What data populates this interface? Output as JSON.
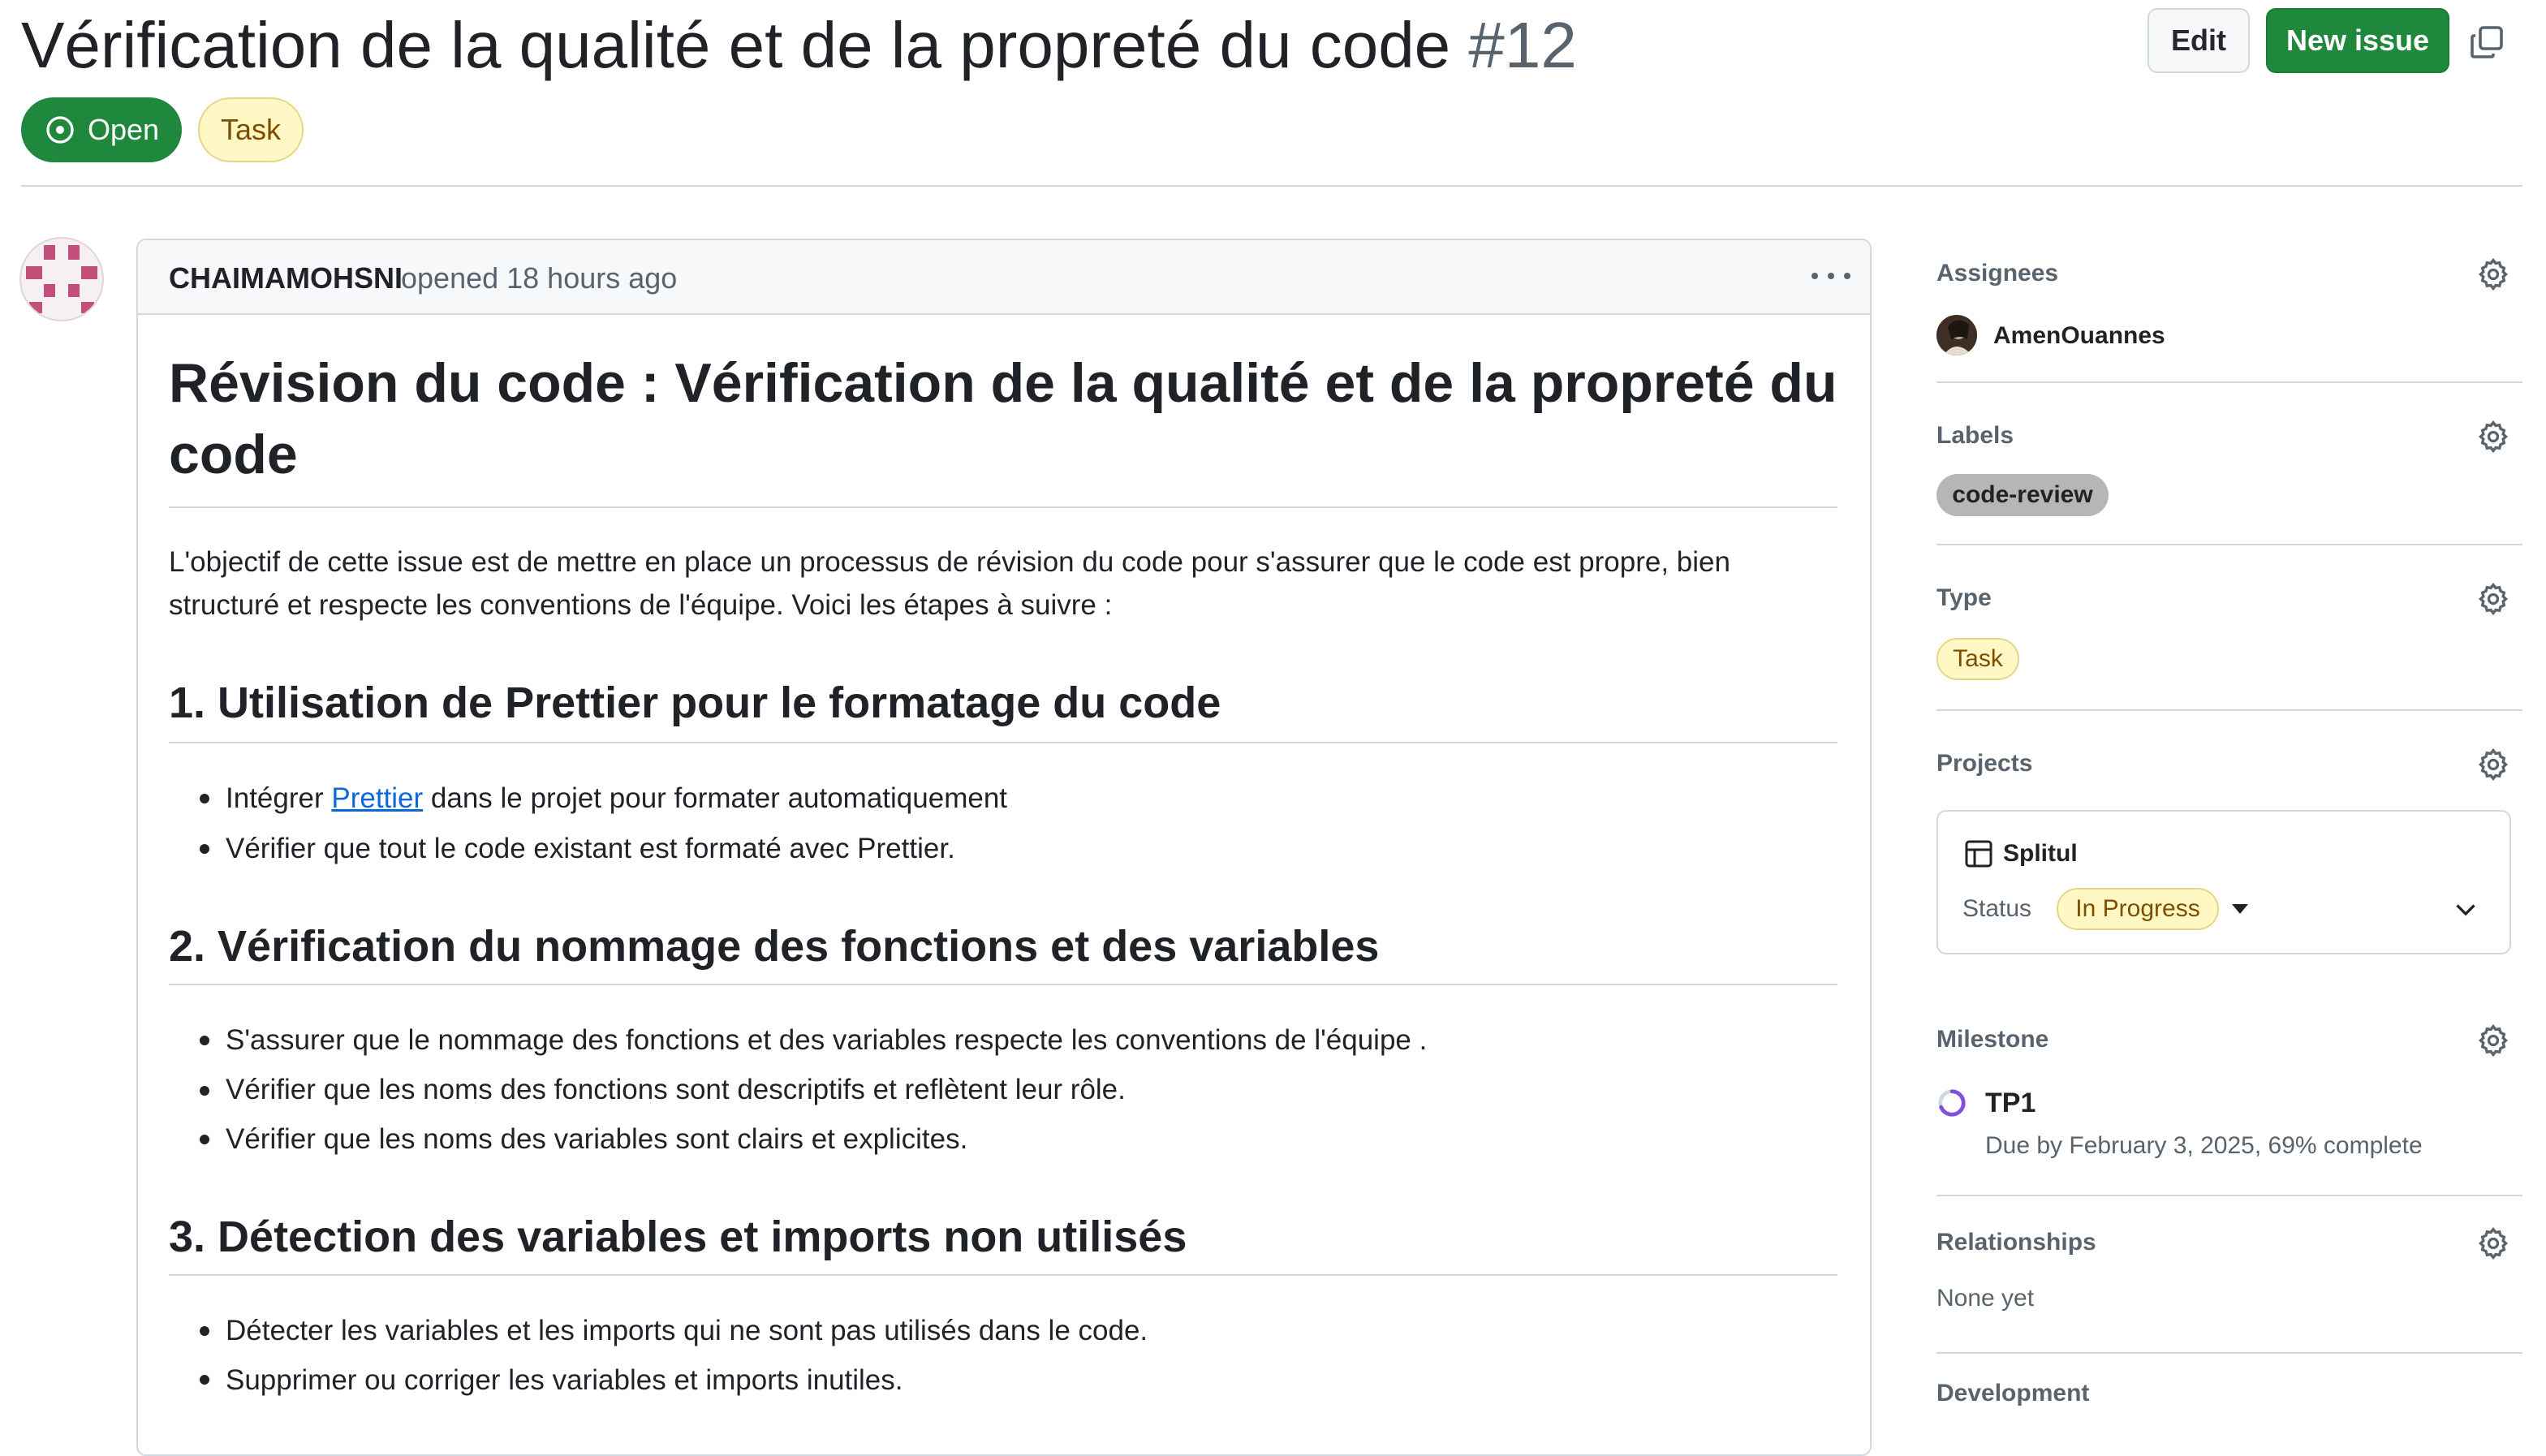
{
  "issue": {
    "title": "Vérification de la qualité et de la propreté du code",
    "number": "#12",
    "state": "Open",
    "type": "Task"
  },
  "toolbar": {
    "edit_label": "Edit",
    "new_issue_label": "New issue"
  },
  "comment": {
    "author": "CHAIMAMOHSNI",
    "opened_text": "opened 18 hours ago",
    "heading": "Révision du code : Vérification de la qualité et de la propreté du code",
    "intro": "L'objectif de cette issue est de mettre en place un processus de révision du code pour s'assurer que le code est propre, bien structuré et respecte les conventions de l'équipe. Voici les étapes à suivre :",
    "sections": [
      {
        "title": "1. Utilisation de Prettier pour le formatage du code",
        "items": [
          {
            "before": "Intégrer ",
            "link": "Prettier",
            "after": " dans le projet pour formater automatiquement"
          },
          {
            "text": "Vérifier que tout le code existant est formaté avec Prettier."
          }
        ]
      },
      {
        "title": "2. Vérification du nommage des fonctions et des variables",
        "items": [
          {
            "text": "S'assurer que le nommage des fonctions et des variables respecte les conventions de l'équipe ."
          },
          {
            "text": "Vérifier que les noms des fonctions sont descriptifs et reflètent leur rôle."
          },
          {
            "text": "Vérifier que les noms des variables sont clairs et explicites."
          }
        ]
      },
      {
        "title": "3. Détection des variables et imports non utilisés",
        "items": [
          {
            "text": "Détecter les variables et les imports qui ne sont pas utilisés dans le code."
          },
          {
            "text": "Supprimer ou corriger les variables et imports inutiles."
          }
        ]
      }
    ]
  },
  "sidebar": {
    "assignees": {
      "label": "Assignees",
      "user": "AmenOuannes"
    },
    "labels": {
      "label": "Labels",
      "value": "code-review"
    },
    "type": {
      "label": "Type",
      "value": "Task"
    },
    "projects": {
      "label": "Projects",
      "project_name": "Splitul",
      "status_label": "Status",
      "status_value": "In Progress"
    },
    "milestone": {
      "label": "Milestone",
      "name": "TP1",
      "due": "Due by February 3, 2025, 69% complete",
      "progress": 0.69
    },
    "relationships": {
      "label": "Relationships",
      "value": "None yet"
    },
    "development": {
      "label": "Development"
    }
  },
  "colors": {
    "open_green": "#1f883d",
    "link_blue": "#0969da",
    "muted": "#59636e",
    "border": "#d1d9e0",
    "task_yellow": "#fff8c5",
    "label_gray": "#b6b6b6",
    "milestone_purple": "#8250df"
  },
  "icons": {
    "state": "issue-opened-icon",
    "copy": "copy-icon",
    "more": "kebab-horizontal-icon",
    "settings": "gear-icon",
    "project": "table-icon",
    "milestone": "milestone-progress-icon",
    "expand": "chevron-down-icon"
  }
}
